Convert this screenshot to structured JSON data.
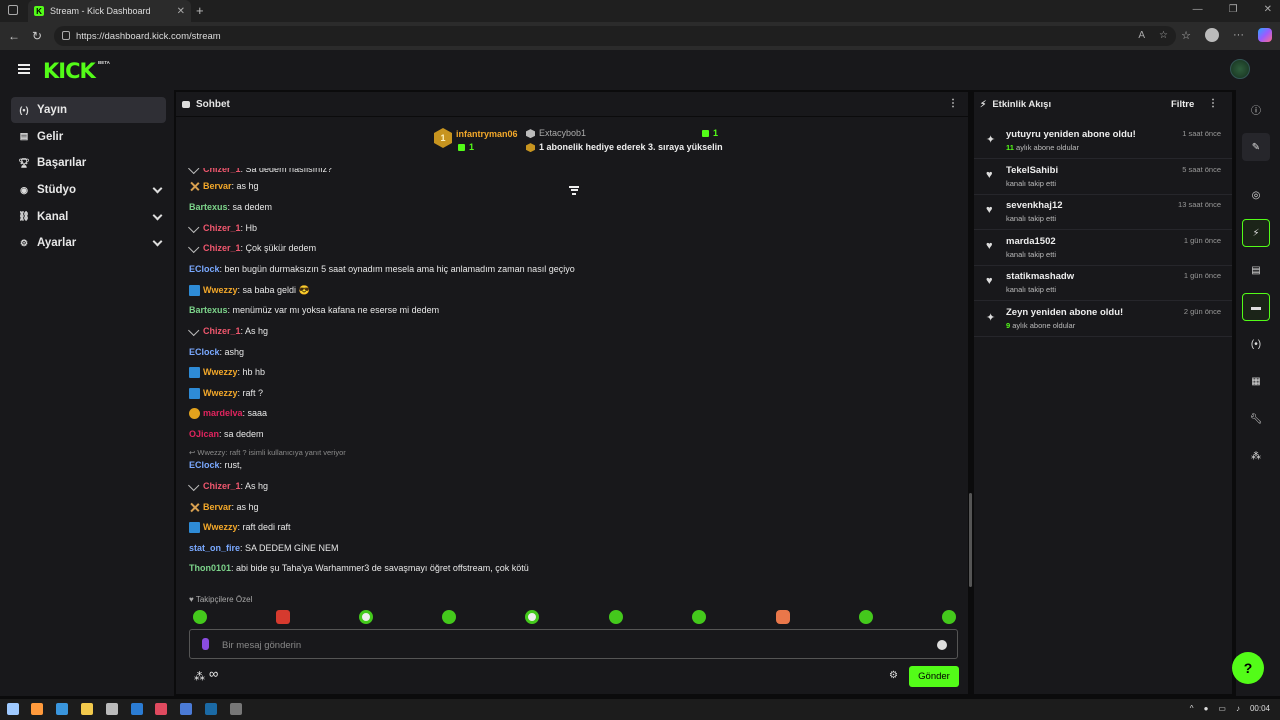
{
  "browser": {
    "tab_title": "Stream - Kick Dashboard",
    "url": "https://dashboard.kick.com/stream"
  },
  "app": {
    "logo": "KICK",
    "logo_badge": "BETA"
  },
  "nav": {
    "items": [
      {
        "label": "Yayın",
        "icon": "broadcast-icon"
      },
      {
        "label": "Gelir",
        "icon": "revenue-icon"
      },
      {
        "label": "Başarılar",
        "icon": "trophy-icon"
      },
      {
        "label": "Stüdyo",
        "icon": "studio-icon"
      },
      {
        "label": "Kanal",
        "icon": "channel-icon"
      },
      {
        "label": "Ayarlar",
        "icon": "settings-icon"
      }
    ]
  },
  "chat": {
    "title": "Sohbet",
    "pinned": {
      "rank": "1",
      "user1": "infantryman06",
      "user1_count": "1",
      "user2": "Extacybob1",
      "user2_count": "1",
      "message": "1 abonelik hediye ederek 3. sıraya yükselin"
    },
    "messages": [
      {
        "user": "Chizer_1",
        "text": ": Sa dedem nasılsınız?",
        "color": "#f0576e",
        "badge": "chev"
      },
      {
        "user": "Bervar",
        "text": ": as hg",
        "color": "#f3a82a",
        "badge": "sword"
      },
      {
        "user": "Bartexus",
        "text": ": sa dedem",
        "color": "#7cd38a",
        "badge": ""
      },
      {
        "user": "Chizer_1",
        "text": ": Hb",
        "color": "#f0576e",
        "badge": "chev"
      },
      {
        "user": "Chizer_1",
        "text": ": Çok şükür dedem",
        "color": "#f0576e",
        "badge": "chev"
      },
      {
        "user": "EClock",
        "text": ": ben bugün durmaksızın 5 saat oynadım mesela ama hiç anlamadım zaman nasıl geçiyo",
        "color": "#7aa9ff",
        "badge": ""
      },
      {
        "user": "Wwezzy",
        "text": ": sa baba geldi 😎",
        "color": "#f3a82a",
        "badge": "blue"
      },
      {
        "user": "Bartexus",
        "text": ": menümüz var mı yoksa kafana ne eserse mi dedem",
        "color": "#7cd38a",
        "badge": ""
      },
      {
        "user": "Chizer_1",
        "text": ": As hg",
        "color": "#f0576e",
        "badge": "chev"
      },
      {
        "user": "EClock",
        "text": ": ashg",
        "color": "#7aa9ff",
        "badge": ""
      },
      {
        "user": "Wwezzy",
        "text": ": hb hb",
        "color": "#f3a82a",
        "badge": "blue"
      },
      {
        "user": "Wwezzy",
        "text": ": raft ?",
        "color": "#f3a82a",
        "badge": "blue"
      },
      {
        "user": "mardelva",
        "text": ": saaa",
        "color": "#e0245e",
        "badge": "gold"
      },
      {
        "user": "OJican",
        "text": ": sa dedem",
        "color": "#e0245e",
        "badge": ""
      },
      {
        "user": "EClock",
        "text": ": rust,",
        "color": "#7aa9ff",
        "badge": ""
      },
      {
        "user": "Chizer_1",
        "text": ": As hg",
        "color": "#f0576e",
        "badge": "chev"
      },
      {
        "user": "Bervar",
        "text": ": as hg",
        "color": "#f3a82a",
        "badge": "sword"
      },
      {
        "user": "Wwezzy",
        "text": ": raft dedi raft",
        "color": "#f3a82a",
        "badge": "blue"
      },
      {
        "user": "stat_on_fire",
        "text": ": SA DEDEM GİNE NEM",
        "color": "#7aa9ff",
        "badge": ""
      },
      {
        "user": "Thon0101",
        "text": ": abi bide şu Taha'ya Warhammer3 de savaşmayı öğret offstream, çok kötü",
        "color": "#7cd38a",
        "badge": ""
      }
    ],
    "reply_note": "Wwezzy: raft ? isimli kullanıcıya yanıt veriyor",
    "followers_only": "Takipçilere Özel",
    "input_placeholder": "Bir mesaj gönderin",
    "send_label": "Gönder"
  },
  "activity": {
    "title": "Etkinlik Akışı",
    "filter_label": "Filtre",
    "events": [
      {
        "icon": "sparkle-icon",
        "title": "yutuyru yeniden abone oldu!",
        "count": "11",
        "sub": " aylık abone oldular",
        "time": "1 saat önce"
      },
      {
        "icon": "heart-icon",
        "title": "TekelSahibi",
        "count": "",
        "sub": "kanalı takip etti",
        "time": "5 saat önce"
      },
      {
        "icon": "heart-icon",
        "title": "sevenkhaj12",
        "count": "",
        "sub": "kanalı takip etti",
        "time": "13 saat önce"
      },
      {
        "icon": "heart-icon",
        "title": "marda1502",
        "count": "",
        "sub": "kanalı takip etti",
        "time": "1 gün önce"
      },
      {
        "icon": "heart-icon",
        "title": "statikmashadw",
        "count": "",
        "sub": "kanalı takip etti",
        "time": "1 gün önce"
      },
      {
        "icon": "sparkle-icon",
        "title": "Zeyn yeniden abone oldu!",
        "count": "9",
        "sub": " aylık abone oldular",
        "time": "2 gün önce"
      }
    ]
  },
  "taskbar": {
    "time": "00:04"
  }
}
